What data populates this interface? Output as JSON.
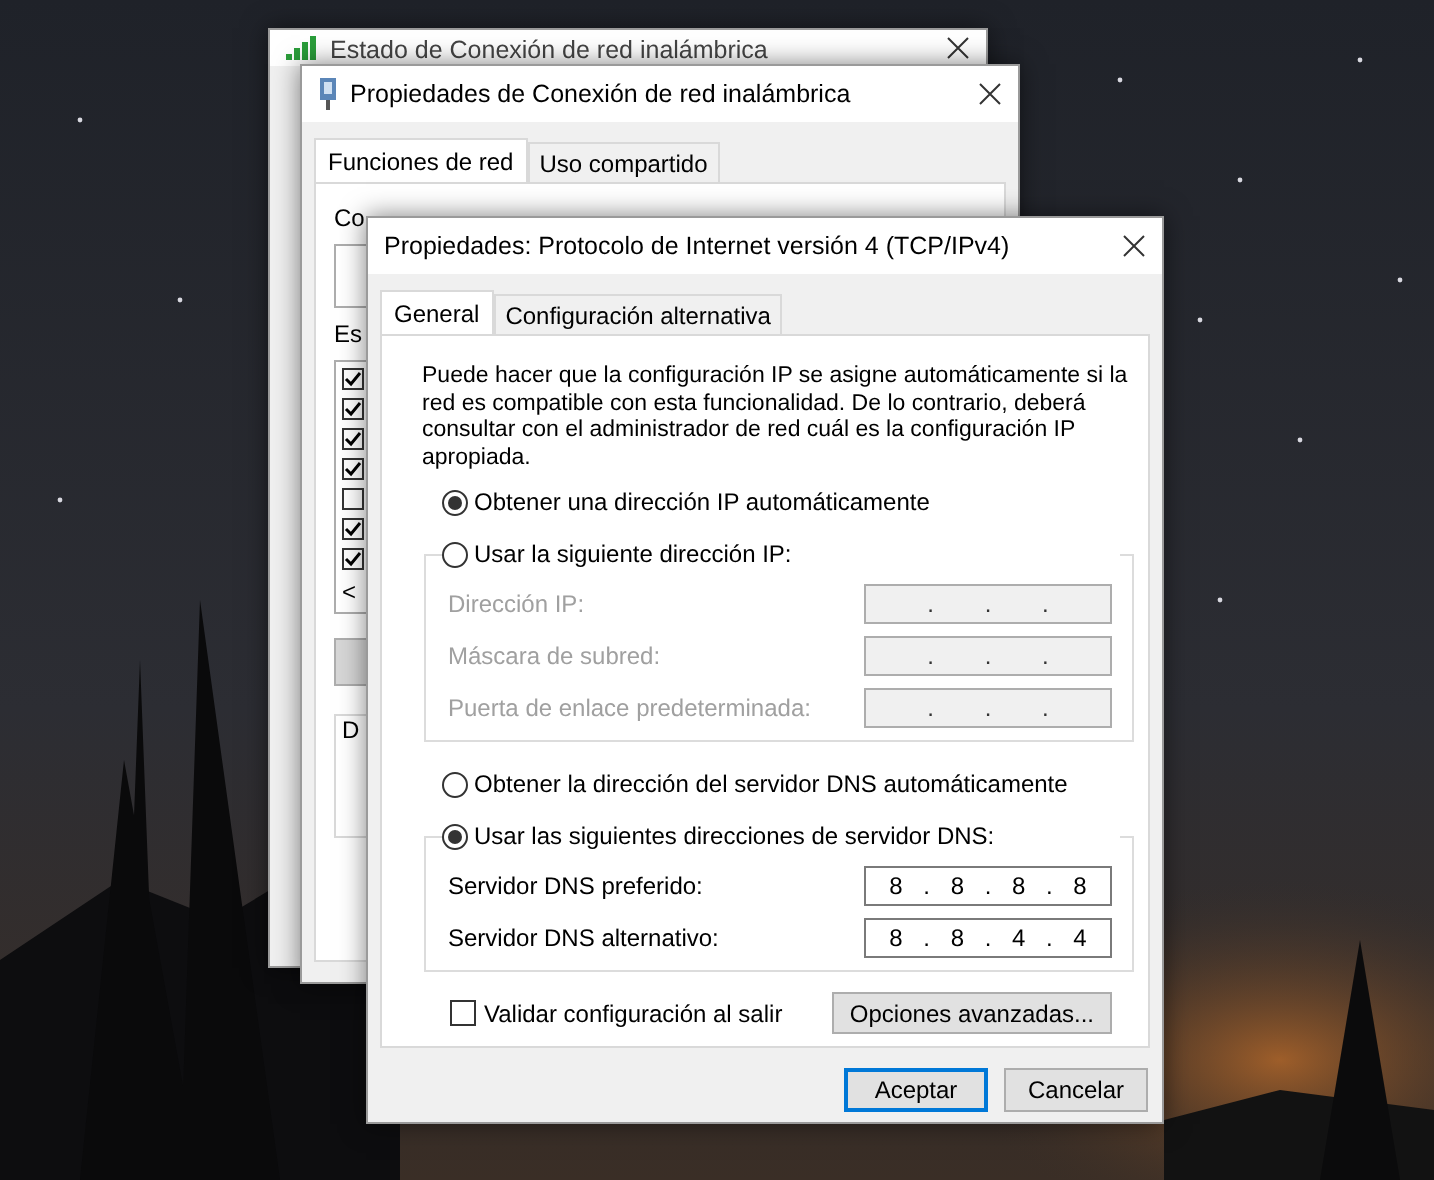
{
  "status_window": {
    "title": "Estado de Conexión de red inalámbrica"
  },
  "properties_window": {
    "title": "Propiedades de Conexión de red inalámbrica",
    "tabs": [
      {
        "label": "Funciones de red",
        "selected": true
      },
      {
        "label": "Uso compartido",
        "selected": false
      }
    ],
    "connect_label": "Co",
    "items_label": "Es",
    "components": [
      {
        "checked": true
      },
      {
        "checked": true
      },
      {
        "checked": true
      },
      {
        "checked": true
      },
      {
        "checked": false
      },
      {
        "checked": true
      },
      {
        "checked": true
      }
    ],
    "scroll_arrow": "<",
    "group_label": "D"
  },
  "ipv4_window": {
    "title": "Propiedades: Protocolo de Internet versión 4 (TCP/IPv4)",
    "tabs": [
      {
        "label": "General",
        "selected": true
      },
      {
        "label": "Configuración alternativa",
        "selected": false
      }
    ],
    "description": "Puede hacer que la configuración IP se asigne automáticamente si la red es compatible con esta funcionalidad. De lo contrario, deberá consultar con el administrador de red cuál es la configuración IP apropiada.",
    "ip_options": [
      {
        "label": "Obtener una dirección IP automáticamente",
        "selected": true
      },
      {
        "label": "Usar la siguiente dirección IP:",
        "selected": false
      }
    ],
    "ip_fields": [
      {
        "label": "Dirección IP:",
        "value": ". . .",
        "disabled": true
      },
      {
        "label": "Máscara de subred:",
        "value": ". . .",
        "disabled": true
      },
      {
        "label": "Puerta de enlace predeterminada:",
        "value": ". . .",
        "disabled": true
      }
    ],
    "dns_options": [
      {
        "label": "Obtener la dirección del servidor DNS automáticamente",
        "selected": false
      },
      {
        "label": "Usar las siguientes direcciones de servidor DNS:",
        "selected": true
      }
    ],
    "dns_fields": [
      {
        "label": "Servidor DNS preferido:",
        "value": "8 . 8 . 8 . 8",
        "disabled": false
      },
      {
        "label": "Servidor DNS alternativo:",
        "value": "8 . 8 . 4 . 4",
        "disabled": false
      }
    ],
    "validate": {
      "label": "Validar configuración al salir",
      "checked": false
    },
    "advanced_button": "Opciones avanzadas...",
    "buttons": [
      {
        "label": "Aceptar",
        "default": true
      },
      {
        "label": "Cancelar",
        "default": false
      }
    ]
  }
}
